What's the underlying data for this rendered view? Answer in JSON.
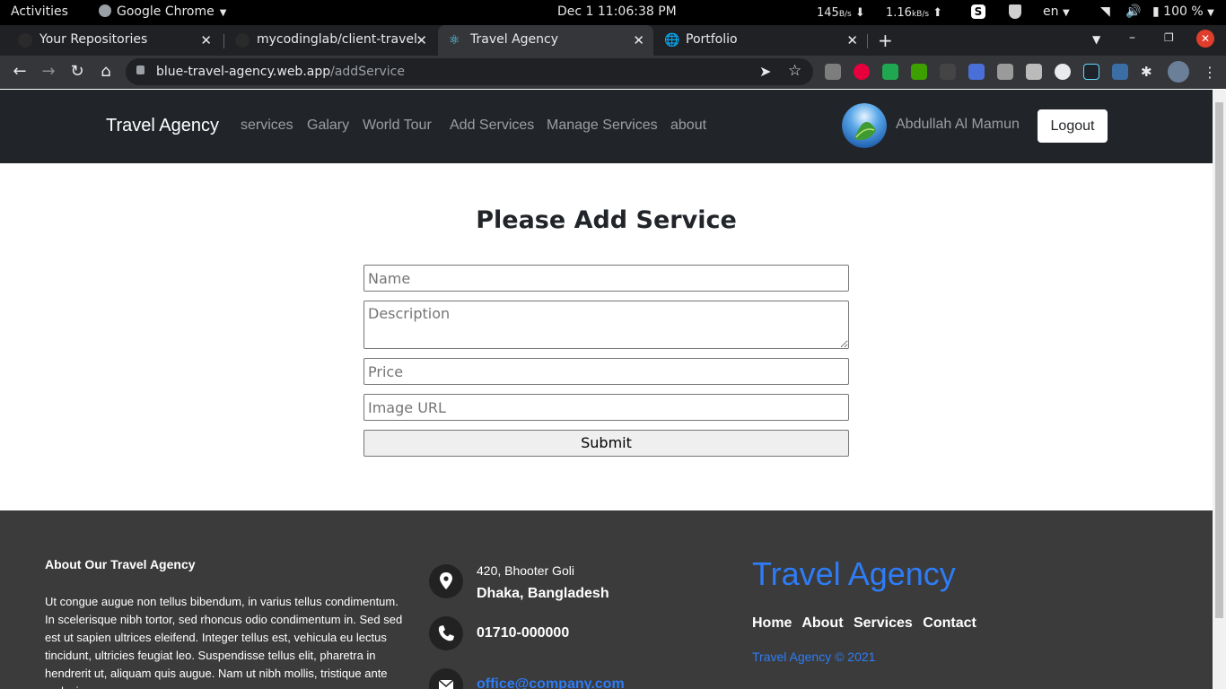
{
  "system": {
    "activities": "Activities",
    "app_name": "Google Chrome",
    "clock": "Dec 1  11:06:38 PM",
    "net_down": "145",
    "net_down_unit": "B/s",
    "net_up": "1.16",
    "net_up_unit": "kB/s",
    "lang": "en",
    "battery": "100 %"
  },
  "browser": {
    "tabs": [
      {
        "title": "Your Repositories",
        "icon": "github-icon"
      },
      {
        "title": "mycodinglab/client-travel",
        "icon": "github-icon"
      },
      {
        "title": "Travel Agency",
        "icon": "react-icon"
      },
      {
        "title": "Portfolio",
        "icon": "globe-icon"
      }
    ],
    "url_host": "blue-travel-agency.web.app",
    "url_path": "/addService"
  },
  "navbar": {
    "brand": "Travel Agency",
    "links": [
      "services",
      "Galary",
      "World Tour",
      "Add Services",
      "Manage Services",
      "about"
    ],
    "username": "Abdullah Al Mamun",
    "logout": "Logout"
  },
  "form": {
    "title": "Please Add Service",
    "name_placeholder": "Name",
    "description_placeholder": "Description",
    "price_placeholder": "Price",
    "image_placeholder": "Image URL",
    "submit": "Submit"
  },
  "footer": {
    "about_title": "About Our Travel Agency",
    "about_text": "Ut congue augue non tellus bibendum, in varius tellus condimentum. In scelerisque nibh tortor, sed rhoncus odio condimentum in. Sed sed est ut sapien ultrices eleifend. Integer tellus est, vehicula eu lectus tincidunt, ultricies feugiat leo. Suspendisse tellus elit, pharetra in hendrerit ut, aliquam quis augue. Nam ut nibh mollis, tristique ante sed, viverra massa.",
    "address_line1": "420, Bhooter Goli",
    "address_line2": "Dhaka, Bangladesh",
    "phone": "01710-000000",
    "email": "office@company.com",
    "brand": "Travel Agency",
    "links": [
      "Home",
      "About",
      "Services",
      "Contact"
    ],
    "copyright": "Travel Agency © 2021"
  },
  "colors": {
    "navbar_bg": "#212529",
    "footer_bg": "#3b3b3b",
    "accent": "#2e7cf6"
  }
}
